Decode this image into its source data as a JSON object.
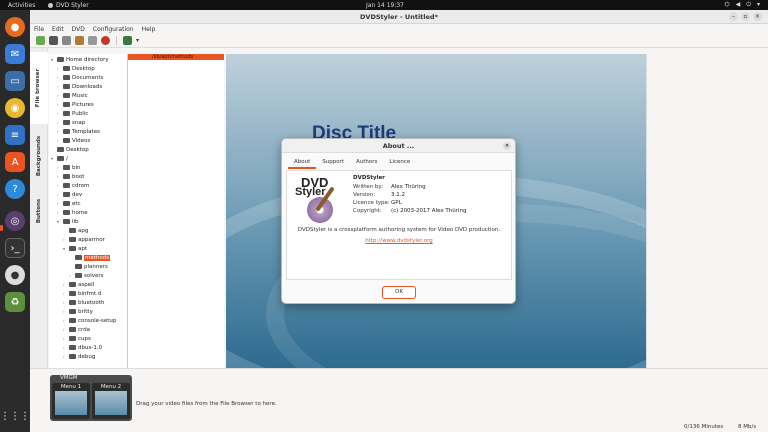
{
  "topbar": {
    "activities": "Activities",
    "app_name": "DVD Styler",
    "clock": "Jan 14  19:37"
  },
  "window": {
    "title": "DVDStyler - Untitled*"
  },
  "menubar": [
    "File",
    "Edit",
    "DVD",
    "Configuration",
    "Help"
  ],
  "side_tabs": {
    "file_browser": "File browser",
    "backgrounds": "Backgrounds",
    "buttons": "Buttons"
  },
  "tree": {
    "home": "Home directory",
    "home_children": [
      "Desktop",
      "Documents",
      "Downloads",
      "Music",
      "Pictures",
      "Public",
      "snap",
      "Templates",
      "Videos"
    ],
    "desktop": "Desktop",
    "root": "/",
    "root_children": [
      "bin",
      "boot",
      "cdrom",
      "dev",
      "etc",
      "home",
      "lib"
    ],
    "lib_children": [
      "apg",
      "apparmor",
      "apt"
    ],
    "apt_children": [
      "methods",
      "planners",
      "solvers"
    ],
    "lib_more": [
      "aspell",
      "binfmt.d",
      "bluetooth",
      "brltty",
      "console-setup",
      "crda",
      "cups",
      "dbus-1.0",
      "debug"
    ]
  },
  "path": "/lib/apt/methods",
  "menu_preview": {
    "disc_title": "Disc Title"
  },
  "bottom": {
    "vmgm_label": "VMGM",
    "menus": [
      "Menu 1",
      "Menu 2"
    ],
    "drag_hint": "Drag your video files from the File Browser to here."
  },
  "status": {
    "size": "0/136 Minutes",
    "rate": "8 Mb/s"
  },
  "about": {
    "title": "About ...",
    "tabs": [
      "About",
      "Support",
      "Authors",
      "Licence"
    ],
    "logo_line1": "DVD",
    "logo_line2": "Styler",
    "app_name": "DVDStyler",
    "written_by_label": "Written by:",
    "written_by": "Alex Thüring",
    "version_label": "Version:",
    "version": "3.1.2",
    "licence_label": "Licence type:",
    "licence": "GPL",
    "copyright_label": "Copyright:",
    "copyright": "(c) 2003-2017 Alex Thüring",
    "description": "DVDStyler is a crossplatform authoring system for Video DVD production.",
    "link": "http://www.dvdstyler.org",
    "ok": "OK"
  },
  "colors": {
    "accent": "#e95420",
    "title_text": "#1c3c78"
  }
}
